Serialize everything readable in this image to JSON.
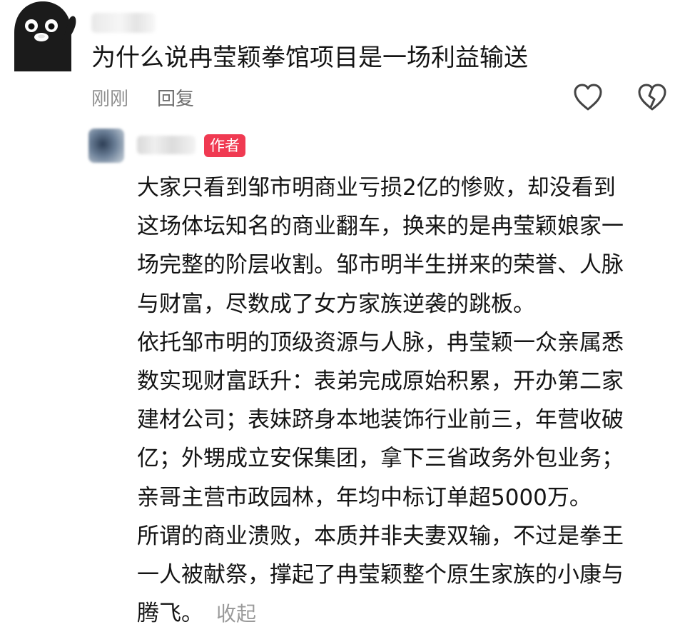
{
  "comment": {
    "text": "为什么说冉莹颖拳馆项目是一场利益输送",
    "timestamp": "刚刚",
    "reply_label": "回复",
    "like_icon": "heart-outline-icon",
    "dislike_icon": "broken-heart-icon"
  },
  "reply": {
    "badge": "作者",
    "lines": [
      "大家只看到邹市明商业亏损2亿的惨败，却没看到",
      "这场体坛知名的商业翻车，换来的是冉莹颖娘家一",
      "场完整的阶层收割。邹市明半生拼来的荣誉、人脉",
      "与财富，尽数成了女方家族逆袭的跳板。",
      "依托邹市明的顶级资源与人脉，冉莹颖一众亲属悉",
      "数实现财富跃升：表弟完成原始积累，开办第二家",
      "建材公司；表妹跻身本地装饰行业前三，年营收破",
      "亿；外甥成立安保集团，拿下三省政务外包业务；",
      "亲哥主营市政园林，年均中标订单超5000万。",
      "所谓的商业溃败，本质并非夫妻双输，不过是拳王",
      "一人被献祭，撑起了冉莹颖整个原生家族的小康与",
      "腾飞。"
    ],
    "collapse_label": "收起"
  }
}
